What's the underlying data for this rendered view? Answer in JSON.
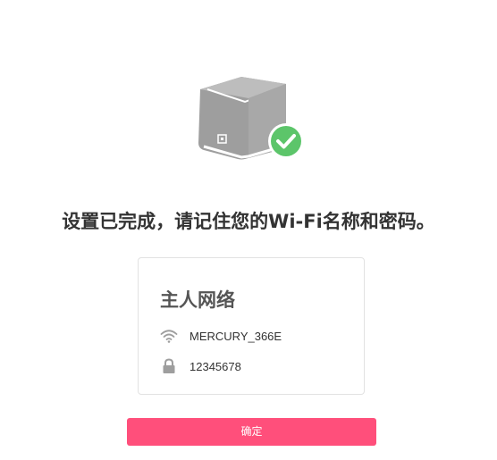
{
  "headline": "设置已完成，请记住您的Wi-Fi名称和密码。",
  "card": {
    "title": "主人网络",
    "ssid": "MERCURY_366E",
    "password": "12345678",
    "ssid_icon": "wifi-icon",
    "password_icon": "lock-icon"
  },
  "confirm_label": "确定",
  "colors": {
    "accent": "#ff4f7b",
    "success": "#5cc56a",
    "router": "#9e9e9e",
    "text": "#333333"
  }
}
